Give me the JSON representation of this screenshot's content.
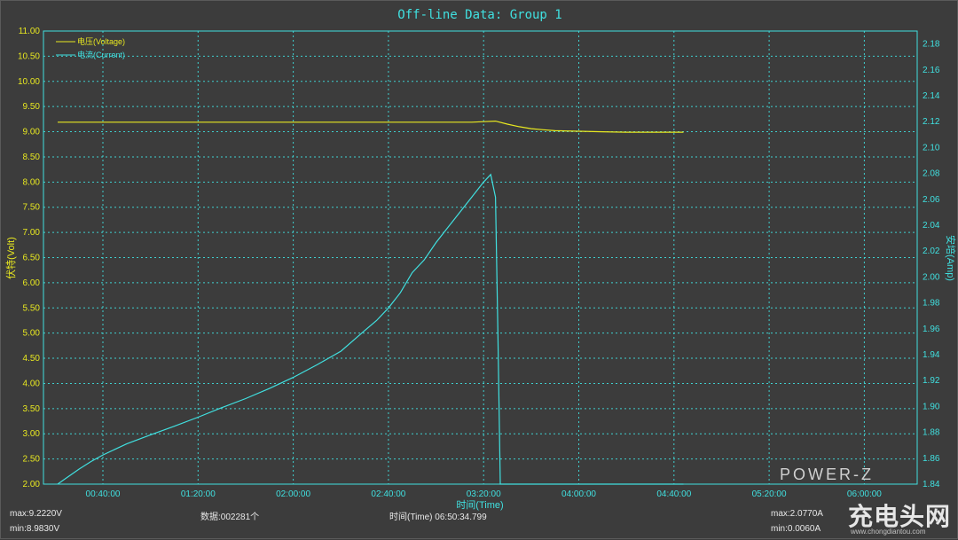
{
  "colors": {
    "background": "#3c3c3c",
    "plot_border": "#40e0e0",
    "grid": "#40e0e0",
    "voltage": "#e8e820",
    "current": "#40e0e0"
  },
  "chart_data": {
    "type": "line",
    "title": "Off-line Data: Group 1",
    "xlabel": "时间(Time)",
    "ylabel_left": "伏特(Volt)",
    "ylabel_right": "安培(Amp)",
    "x_unit": "minutes",
    "xlim": [
      21,
      284
    ],
    "ylim_left": [
      2.0,
      11.0
    ],
    "ylim_right": [
      1.84,
      2.19
    ],
    "grid": true,
    "legend_position": "top-left",
    "x_ticks": [
      "00:40:00",
      "01:20:00",
      "02:00:00",
      "02:40:00",
      "03:20:00",
      "04:00:00",
      "04:40:00",
      "05:20:00",
      "06:00:00"
    ],
    "x_tick_values": [
      40,
      80,
      120,
      160,
      200,
      240,
      280,
      320,
      360
    ],
    "y_ticks_left": [
      "2.00",
      "2.50",
      "3.00",
      "3.50",
      "4.00",
      "4.50",
      "5.00",
      "5.50",
      "6.00",
      "6.50",
      "7.00",
      "7.50",
      "8.00",
      "8.50",
      "9.00",
      "9.50",
      "10.00",
      "10.50",
      "11.00"
    ],
    "y_ticks_right": [
      "1.84",
      "1.86",
      "1.88",
      "1.90",
      "1.92",
      "1.94",
      "1.96",
      "1.98",
      "2.00",
      "2.02",
      "2.04",
      "2.06",
      "2.08",
      "2.10",
      "2.12",
      "2.14",
      "2.16",
      "2.18"
    ],
    "series": [
      {
        "name": "电压(Voltage)",
        "axis": "left",
        "x": [
          21,
          60,
          100,
          140,
          180,
          195,
          200,
          205,
          210,
          215,
          220,
          225,
          230,
          240,
          250,
          260,
          270,
          284
        ],
        "y": [
          9.19,
          9.19,
          9.19,
          9.19,
          9.19,
          9.19,
          9.2,
          9.21,
          9.15,
          9.1,
          9.06,
          9.04,
          9.02,
          9.01,
          9.0,
          8.99,
          8.99,
          8.99
        ]
      },
      {
        "name": "电流(Current)",
        "axis": "left",
        "x": [
          21,
          24,
          30,
          35,
          40,
          50,
          60,
          70,
          80,
          90,
          100,
          110,
          120,
          130,
          140,
          150,
          155,
          160,
          165,
          170,
          175,
          180,
          185,
          190,
          195,
          200,
          203,
          205,
          206,
          207,
          210,
          213,
          215,
          220,
          230,
          240,
          250,
          260,
          270,
          284
        ],
        "y": [
          2.0,
          2.1,
          2.3,
          2.45,
          2.58,
          2.8,
          2.98,
          3.15,
          3.33,
          3.52,
          3.7,
          3.9,
          4.12,
          4.37,
          4.64,
          5.05,
          5.25,
          5.5,
          5.8,
          6.2,
          6.45,
          6.8,
          7.1,
          7.4,
          7.7,
          8.0,
          8.15,
          7.7,
          5.0,
          2.0,
          2.0,
          2.0,
          2.0,
          2.0,
          2.0,
          2.0,
          2.0,
          2.0,
          2.0,
          2.0
        ]
      }
    ]
  },
  "stats": {
    "v_max": "max:9.2220V",
    "v_min": "min:8.9830V",
    "count": "数据:002281个",
    "duration": "时间(Time) 06:50:34.799",
    "a_max": "max:2.0770A",
    "a_min": "min:0.0060A"
  },
  "watermark": {
    "top": "POWER-Z",
    "brand": "充电头网",
    "url": "www.chongdiantou.com"
  }
}
